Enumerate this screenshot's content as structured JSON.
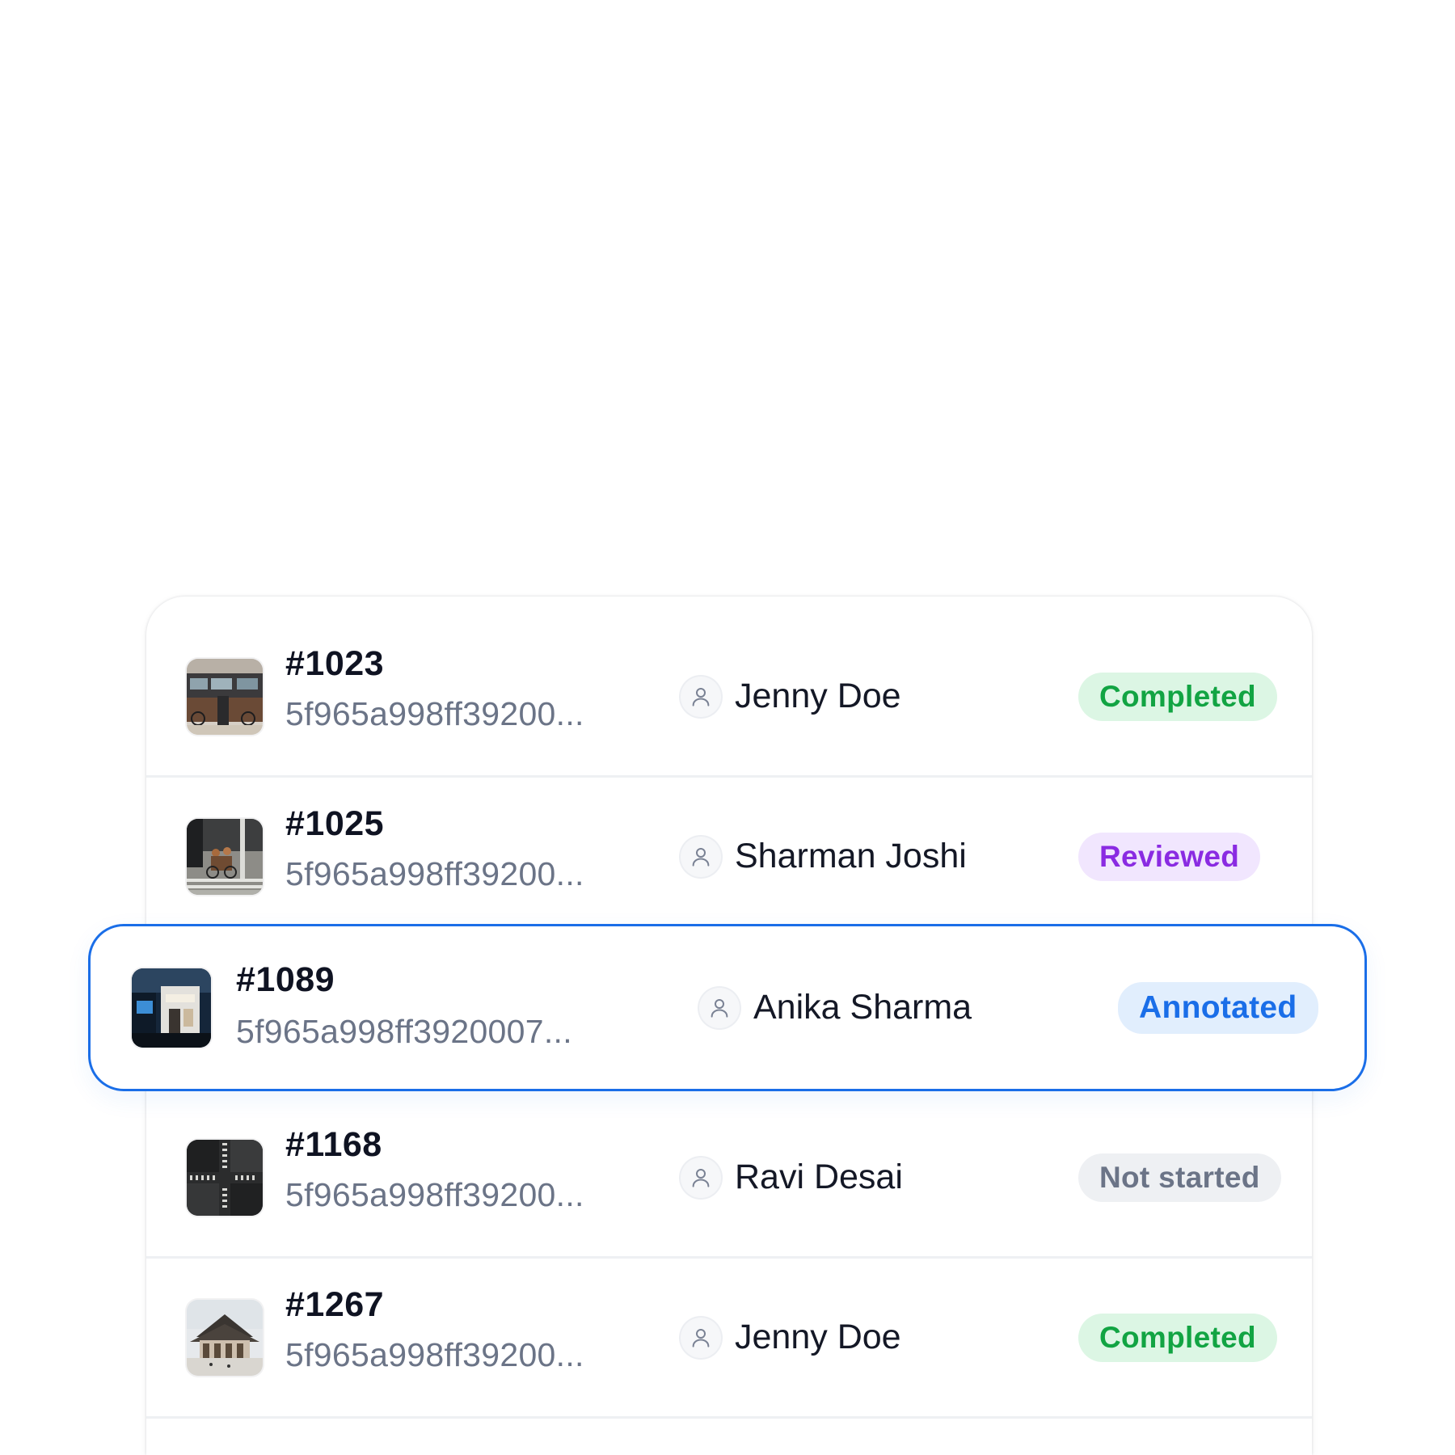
{
  "rows": [
    {
      "id": "#1023",
      "hash": "5f965a998ff39200...",
      "assignee": "Jenny Doe",
      "status": "Completed",
      "status_colors": {
        "bg": "#dcf6e4",
        "fg": "#12a443"
      },
      "thumb_icon": "street-photo-thumbnail"
    },
    {
      "id": "#1025",
      "hash": "5f965a998ff39200...",
      "assignee": "Sharman Joshi",
      "status": "Reviewed",
      "status_colors": {
        "bg": "#f1e6fe",
        "fg": "#8a2be2"
      },
      "thumb_icon": "crosswalk-people-thumbnail"
    },
    {
      "id": "#1089",
      "hash": "5f965a998ff3920007...",
      "assignee": "Anika Sharma",
      "status": "Annotated",
      "status_colors": {
        "bg": "#e1eefd",
        "fg": "#1a6ee8"
      },
      "thumb_icon": "storefront-night-thumbnail",
      "selected": true
    },
    {
      "id": "#1168",
      "hash": "5f965a998ff39200...",
      "assignee": "Ravi Desai",
      "status": "Not started",
      "status_colors": {
        "bg": "#eef0f3",
        "fg": "#6b7487"
      },
      "thumb_icon": "aerial-crosswalk-thumbnail"
    },
    {
      "id": "#1267",
      "hash": "5f965a998ff39200...",
      "assignee": "Jenny Doe",
      "status": "Completed",
      "status_colors": {
        "bg": "#dcf6e4",
        "fg": "#12a443"
      },
      "thumb_icon": "temple-building-thumbnail"
    }
  ],
  "icons": {
    "assignee": "user-icon"
  },
  "colors": {
    "selection_border": "#1a6ee8",
    "row_divider": "#eef0f3"
  }
}
